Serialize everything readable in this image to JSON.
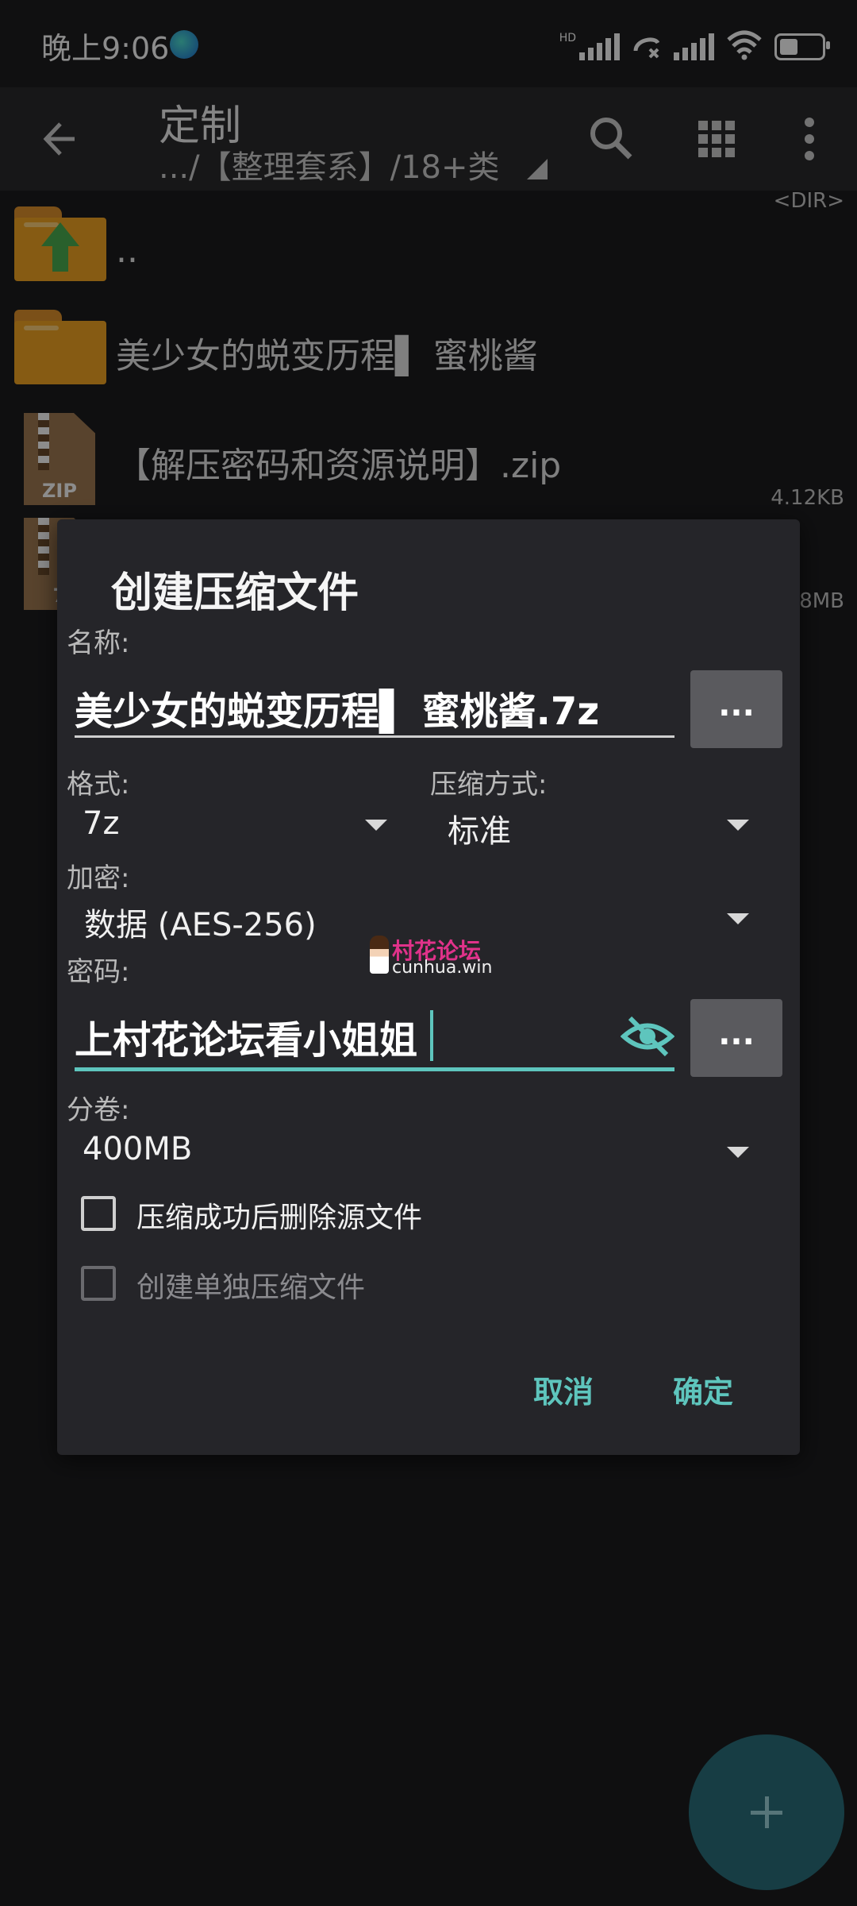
{
  "status_bar": {
    "time": "晚上9:06",
    "hd_label": "HD",
    "battery_level": 0.4
  },
  "toolbar": {
    "title": "定制",
    "path": ".../【整理套系】/18+类"
  },
  "file_list": [
    {
      "name": "..",
      "meta": "",
      "type": "parent-folder"
    },
    {
      "name": "美少女的蜕变历程▌ 蜜桃酱",
      "meta": "<DIR>",
      "type": "folder"
    },
    {
      "name": "【解压密码和资源说明】.zip",
      "meta": "4.12KB",
      "type": "zip"
    },
    {
      "name": "",
      "meta": "8MB",
      "type": "7z"
    }
  ],
  "dialog": {
    "title": "创建压缩文件",
    "name_label": "名称:",
    "name_value": "美少女的蜕变历程▌ 蜜桃酱.7z",
    "more_label": "...",
    "format_label": "格式:",
    "format_value": "7z",
    "compression_label": "压缩方式:",
    "compression_value": "标准",
    "encryption_label": "加密:",
    "encryption_value": "数据 (AES-256)",
    "password_label": "密码:",
    "password_value": "上村花论坛看小姐姐",
    "volume_label": "分卷:",
    "volume_value": "400MB",
    "delete_source_label": "压缩成功后删除源文件",
    "separate_archive_label": "创建单独压缩文件",
    "cancel_label": "取消",
    "ok_label": "确定"
  },
  "watermark": {
    "line1": "村花论坛",
    "line2": "cunhua.win"
  },
  "colors": {
    "accent": "#5ec5bd",
    "folder": "#f5a623",
    "dialog_bg": "#252529",
    "fab": "#2a6f7c"
  }
}
